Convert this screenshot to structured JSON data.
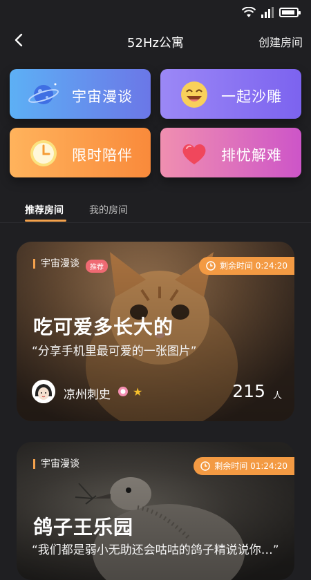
{
  "header": {
    "title": "52Hz公寓",
    "create_label": "创建房间"
  },
  "categories": [
    {
      "label": "宇宙漫谈"
    },
    {
      "label": "一起沙雕"
    },
    {
      "label": "限时陪伴"
    },
    {
      "label": "排忧解难"
    }
  ],
  "tabs": [
    {
      "label": "推荐房间"
    },
    {
      "label": "我的房间"
    }
  ],
  "rooms": [
    {
      "category": "宇宙漫谈",
      "badge": "推荐",
      "timer": "剩余时间 0:24:20",
      "title": "吃可爱多长大的",
      "desc": "“分享手机里最可爱的一张图片”",
      "host": "凉州刺史",
      "count": "215",
      "unit": "人"
    },
    {
      "category": "宇宙漫谈",
      "timer": "剩余时间 01:24:20",
      "title": "鸽子王乐园",
      "desc": "“我们都是弱小无助还会咕咕的鸽子精说说你…”"
    }
  ],
  "colors": {
    "accent": "#f4a24d",
    "badge": "#ef6a73",
    "timer": "#f39a43"
  }
}
